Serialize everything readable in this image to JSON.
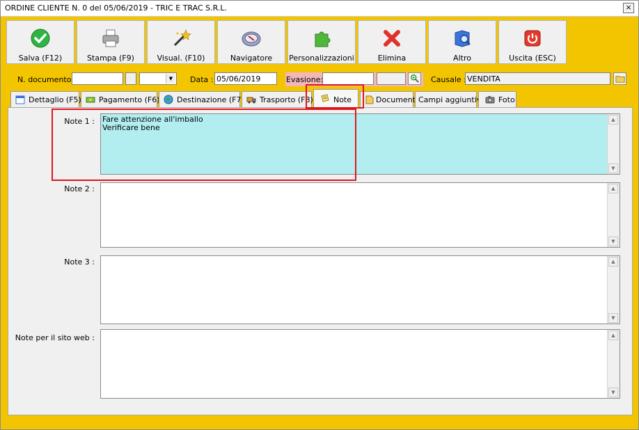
{
  "window": {
    "title": "ORDINE CLIENTE N. 0 del 05/06/2019 - TRIC E TRAC S.R.L.",
    "close_glyph": "×"
  },
  "toolbar": [
    {
      "label": "Salva (F12)",
      "icon": "check-icon"
    },
    {
      "label": "Stampa (F9)",
      "icon": "printer-icon"
    },
    {
      "label": "Visual. (F10)",
      "icon": "magic-wand-icon"
    },
    {
      "label": "Navigatore",
      "icon": "compass-icon"
    },
    {
      "label": "Personalizzazioni",
      "icon": "puzzle-icon"
    },
    {
      "label": "Elimina",
      "icon": "delete-x-icon"
    },
    {
      "label": "Altro",
      "icon": "book-search-icon"
    },
    {
      "label": "Uscita (ESC)",
      "icon": "power-icon"
    }
  ],
  "fields": {
    "ndoc_label": "N. documento :",
    "ndoc_value": "",
    "series_value": "",
    "data_label": "Data :",
    "data_value": "05/06/2019",
    "evasione_label": "Evasione:",
    "evasione_value": "",
    "evasione_extra": "",
    "causale_label": "Causale :",
    "causale_value": "VENDITA"
  },
  "tabs": [
    {
      "label": "Dettaglio (F5)",
      "icon": "calendar-icon"
    },
    {
      "label": "Pagamento (F6)",
      "icon": "money-icon"
    },
    {
      "label": "Destinazione (F7)",
      "icon": "globe-icon"
    },
    {
      "label": "Trasporto (F8)",
      "icon": "truck-icon"
    },
    {
      "label": "Note",
      "icon": "note-icon",
      "active": true
    },
    {
      "label": "Documenti",
      "icon": "document-icon"
    },
    {
      "label": "Campi aggiuntivi",
      "icon": ""
    },
    {
      "label": "Foto",
      "icon": "camera-icon"
    }
  ],
  "notes": [
    {
      "label": "Note 1 :",
      "text": "Fare attenzione all'imballo\nVerificare bene"
    },
    {
      "label": "Note 2 :",
      "text": ""
    },
    {
      "label": "Note 3 :",
      "text": ""
    },
    {
      "label": "Note per il sito web :",
      "text": ""
    }
  ],
  "colors": {
    "window_bg": "#f3c500",
    "note_filled": "#b2eef0",
    "highlight": "#e0141a",
    "evasione_bg": "#f3b7b7"
  }
}
